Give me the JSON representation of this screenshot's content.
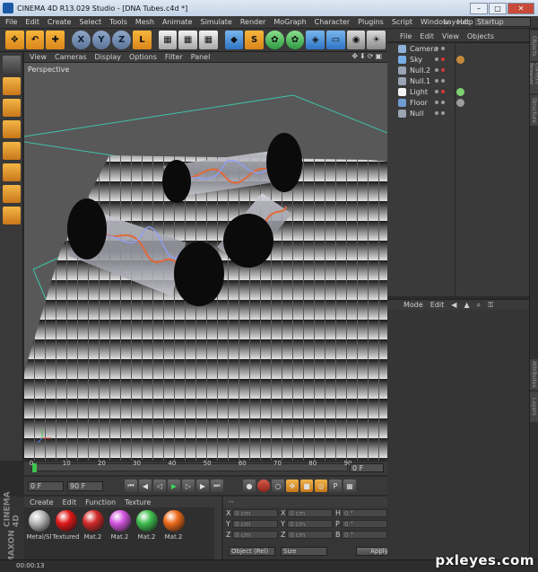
{
  "window": {
    "title": "CINEMA 4D R13.029 Studio - [DNA Tubes.c4d *]",
    "minimize": "–",
    "maximize": "□",
    "close": "✕"
  },
  "menu": {
    "items": [
      "File",
      "Edit",
      "Create",
      "Select",
      "Tools",
      "Mesh",
      "Animate",
      "Simulate",
      "Render",
      "MoGraph",
      "Character",
      "Plugins",
      "Script",
      "Window",
      "Help"
    ],
    "layout_label": "Layout:",
    "layout_value": "Startup"
  },
  "toolbar": {
    "axis_x": "X",
    "axis_y": "Y",
    "axis_z": "Z"
  },
  "viewport": {
    "menu": [
      "View",
      "Cameras",
      "Display",
      "Options",
      "Filter",
      "Panel"
    ],
    "nav_icons": "✥⬇⟳▣",
    "label": "Perspective"
  },
  "timeline": {
    "ticks": [
      "0",
      "10",
      "20",
      "30",
      "40",
      "50",
      "60",
      "70",
      "80",
      "90"
    ],
    "current_frame": "0 F"
  },
  "transport": {
    "start": "0 F",
    "end": "90 F"
  },
  "materials": {
    "menu": [
      "Create",
      "Edit",
      "Function",
      "Texture"
    ],
    "brand_line1": "MAXON",
    "brand_line2": "CINEMA 4D",
    "items": [
      {
        "name": "Metal/Sl",
        "color": "#b8b8b8"
      },
      {
        "name": "Textured",
        "color": "#e01818"
      },
      {
        "name": "Mat.2",
        "color": "#d42a2a"
      },
      {
        "name": "Mat.2",
        "color": "#d457e0"
      },
      {
        "name": "Mat.2",
        "color": "#3fbf4f"
      },
      {
        "name": "Mat.2",
        "color": "#ef6a1a"
      }
    ]
  },
  "coordinates": {
    "header": "--",
    "rows": [
      [
        {
          "axis": "X",
          "value": "0 cm"
        },
        {
          "axis": "X",
          "value": "0 cm"
        },
        {
          "axis": "H",
          "value": "0 °"
        }
      ],
      [
        {
          "axis": "Y",
          "value": "0 cm"
        },
        {
          "axis": "Y",
          "value": "0 cm"
        },
        {
          "axis": "P",
          "value": "0 °"
        }
      ],
      [
        {
          "axis": "Z",
          "value": "0 cm"
        },
        {
          "axis": "Z",
          "value": "0 cm"
        },
        {
          "axis": "B",
          "value": "0 °"
        }
      ]
    ],
    "mode_select": "Object (Rel)",
    "size_select": "Size",
    "apply_label": "Apply"
  },
  "status": {
    "text": "00:00:13"
  },
  "object_manager": {
    "menu": [
      "File",
      "Edit",
      "View",
      "Objects"
    ],
    "objects": [
      {
        "name": "Camera",
        "icon_color": "#8fb2d8",
        "red": false,
        "tag_color": ""
      },
      {
        "name": "Sky",
        "icon_color": "#78aee8",
        "red": true,
        "tag_color": "#c48a3a"
      },
      {
        "name": "Null.2",
        "icon_color": "#9aa4b2",
        "red": true,
        "tag_color": ""
      },
      {
        "name": "Null.1",
        "icon_color": "#9aa4b2",
        "red": false,
        "tag_color": ""
      },
      {
        "name": "Light",
        "icon_color": "#f5f5f5",
        "red": true,
        "tag_color": "#7ed26f"
      },
      {
        "name": "Floor",
        "icon_color": "#6f9bd1",
        "red": false,
        "tag_color": "#9c9c9c"
      },
      {
        "name": "Null",
        "icon_color": "#9aa4b2",
        "red": false,
        "tag_color": ""
      }
    ]
  },
  "attributes": {
    "menu": [
      "Mode",
      "Edit"
    ]
  },
  "side_tabs": [
    "Objects",
    "Content Browser",
    "Structure",
    "Attributes",
    "Layers"
  ],
  "watermark": "pxleyes.com"
}
